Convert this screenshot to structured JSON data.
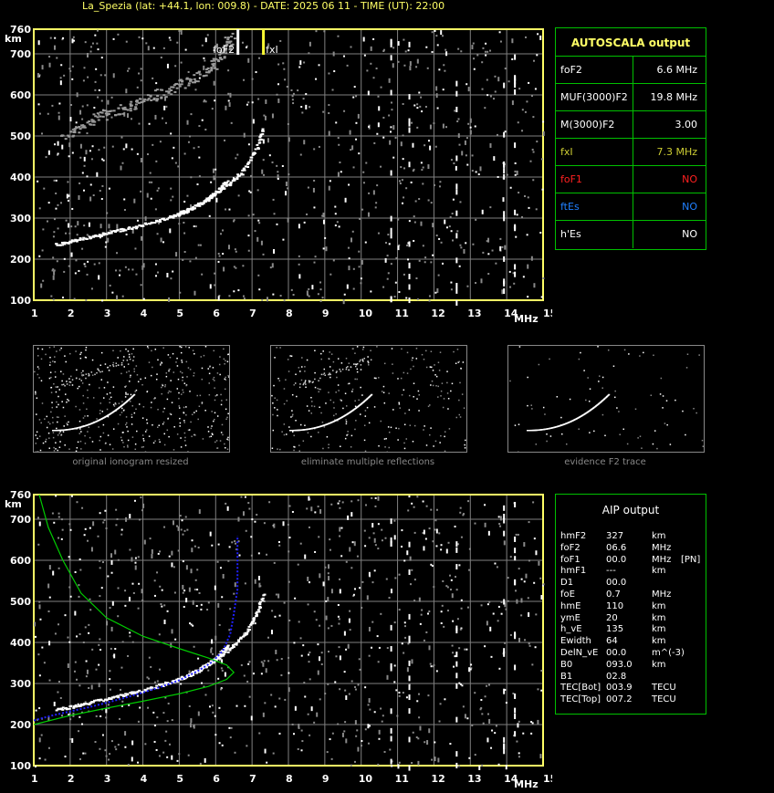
{
  "header": "La_Spezia (lat: +44.1, lon: 009.8) - DATE: 2025 06 11 - TIME (UT): 22:00",
  "colors": {
    "axis": "#ffff66",
    "grid": "#808080",
    "panel": "#00c000",
    "trace_blue": "#2020ff",
    "model_green": "#00cc00",
    "fof1": "#ff2020",
    "ftes": "#2080ff",
    "fxi": "#cccc33"
  },
  "chart_data": [
    {
      "type": "scatter",
      "name": "top-ionogram",
      "xlabel": "MHz",
      "ylabel": "km",
      "xlim": [
        1,
        15
      ],
      "ylim": [
        100,
        760
      ],
      "x_ticks": [
        1,
        2,
        3,
        4,
        5,
        6,
        7,
        8,
        9,
        10,
        11,
        12,
        13,
        14,
        15
      ],
      "y_ticks": [
        100,
        200,
        300,
        400,
        500,
        600,
        700,
        760
      ],
      "annotations": [
        {
          "text": "foF2",
          "x": 6.6
        },
        {
          "text": "fxI",
          "x": 7.3
        }
      ],
      "traces": {
        "o_trace": [
          [
            1.6,
            237
          ],
          [
            2,
            245
          ],
          [
            2.5,
            255
          ],
          [
            3,
            265
          ],
          [
            3.5,
            275
          ],
          [
            4,
            285
          ],
          [
            4.5,
            298
          ],
          [
            5,
            313
          ],
          [
            5.5,
            333
          ],
          [
            5.8,
            350
          ],
          [
            6.1,
            372
          ],
          [
            6.3,
            395
          ]
        ],
        "x_trace": [
          [
            4.8,
            305
          ],
          [
            5.2,
            320
          ],
          [
            5.6,
            340
          ],
          [
            6,
            362
          ],
          [
            6.4,
            388
          ],
          [
            6.8,
            425
          ],
          [
            7.1,
            470
          ],
          [
            7.3,
            520
          ]
        ],
        "multiple_reflections": [
          [
            1.8,
            500
          ],
          [
            2.2,
            520
          ],
          [
            2.6,
            540
          ],
          [
            3,
            555
          ],
          [
            3.4,
            565
          ],
          [
            3.8,
            580
          ],
          [
            4.2,
            595
          ],
          [
            4.6,
            610
          ],
          [
            5,
            625
          ],
          [
            5.4,
            645
          ],
          [
            5.8,
            665
          ],
          [
            6.1,
            690
          ],
          [
            6.3,
            720
          ],
          [
            6.4,
            745
          ]
        ]
      }
    },
    {
      "type": "scatter",
      "name": "bottom-ionogram",
      "xlabel": "MHz",
      "ylabel": "km",
      "xlim": [
        1,
        15
      ],
      "ylim": [
        100,
        760
      ],
      "x_ticks": [
        1,
        2,
        3,
        4,
        5,
        6,
        7,
        8,
        9,
        10,
        11,
        12,
        13,
        14,
        15
      ],
      "y_ticks": [
        100,
        200,
        300,
        400,
        500,
        600,
        700,
        760
      ],
      "traces": {
        "o_trace": [
          [
            1.6,
            237
          ],
          [
            2,
            245
          ],
          [
            2.5,
            255
          ],
          [
            3,
            265
          ],
          [
            3.5,
            275
          ],
          [
            4,
            285
          ],
          [
            4.5,
            298
          ],
          [
            5,
            313
          ],
          [
            5.5,
            333
          ],
          [
            5.8,
            350
          ],
          [
            6.1,
            372
          ],
          [
            6.3,
            395
          ]
        ],
        "x_trace": [
          [
            4.8,
            305
          ],
          [
            5.2,
            320
          ],
          [
            5.6,
            340
          ],
          [
            6,
            362
          ],
          [
            6.4,
            388
          ],
          [
            6.8,
            425
          ],
          [
            7.1,
            470
          ],
          [
            7.3,
            520
          ]
        ],
        "blue_fit": [
          [
            1,
            210
          ],
          [
            1.5,
            222
          ],
          [
            2,
            232
          ],
          [
            2.5,
            242
          ],
          [
            3,
            253
          ],
          [
            3.5,
            265
          ],
          [
            4,
            278
          ],
          [
            4.5,
            292
          ],
          [
            5,
            308
          ],
          [
            5.5,
            330
          ],
          [
            5.9,
            352
          ],
          [
            6.2,
            380
          ],
          [
            6.4,
            420
          ],
          [
            6.5,
            470
          ],
          [
            6.6,
            530
          ],
          [
            6.6,
            600
          ],
          [
            6.6,
            660
          ]
        ],
        "green_profile": [
          [
            1,
            200
          ],
          [
            2,
            222
          ],
          [
            3,
            240
          ],
          [
            4,
            257
          ],
          [
            5,
            275
          ],
          [
            5.8,
            293
          ],
          [
            6.3,
            310
          ],
          [
            6.5,
            327
          ],
          [
            6.3,
            345
          ],
          [
            5.8,
            362
          ],
          [
            5,
            385
          ],
          [
            4,
            415
          ],
          [
            3,
            460
          ],
          [
            2.3,
            520
          ],
          [
            1.8,
            600
          ],
          [
            1.4,
            680
          ],
          [
            1.15,
            760
          ]
        ]
      }
    }
  ],
  "autoscala": {
    "title": "AUTOSCALA output",
    "rows": [
      {
        "label": "foF2",
        "value": "6.6 MHz",
        "lcolor": "#ffffff",
        "vcolor": "#ffffff"
      },
      {
        "label": "MUF(3000)F2",
        "value": "19.8 MHz",
        "lcolor": "#ffffff",
        "vcolor": "#ffffff"
      },
      {
        "label": "M(3000)F2",
        "value": "3.00",
        "lcolor": "#ffffff",
        "vcolor": "#ffffff"
      },
      {
        "label": "fxI",
        "value": "7.3 MHz",
        "lcolor": "#cccc33",
        "vcolor": "#cccc33"
      },
      {
        "label": "foF1",
        "value": "NO",
        "lcolor": "#ff2020",
        "vcolor": "#ff2020"
      },
      {
        "label": "ftEs",
        "value": "NO",
        "lcolor": "#2080ff",
        "vcolor": "#2080ff"
      },
      {
        "label": "h'Es",
        "value": "NO",
        "lcolor": "#ffffff",
        "vcolor": "#ffffff"
      }
    ]
  },
  "aip": {
    "title": "AIP output",
    "rows": [
      {
        "name": "hmF2",
        "value": "327",
        "unit": "km",
        "extra": ""
      },
      {
        "name": "foF2",
        "value": "06.6",
        "unit": "MHz",
        "extra": ""
      },
      {
        "name": "foF1",
        "value": "00.0",
        "unit": "MHz",
        "extra": "[PN]"
      },
      {
        "name": "hmF1",
        "value": "---",
        "unit": "km",
        "extra": ""
      },
      {
        "name": "D1",
        "value": "00.0",
        "unit": "",
        "extra": ""
      },
      {
        "name": "foE",
        "value": "0.7",
        "unit": "MHz",
        "extra": ""
      },
      {
        "name": "hmE",
        "value": "110",
        "unit": "km",
        "extra": ""
      },
      {
        "name": "ymE",
        "value": "20",
        "unit": "km",
        "extra": ""
      },
      {
        "name": "h_vE",
        "value": "135",
        "unit": "km",
        "extra": ""
      },
      {
        "name": "Ewidth",
        "value": "64",
        "unit": "km",
        "extra": ""
      },
      {
        "name": "DelN_vE",
        "value": "00.0",
        "unit": "m^(-3)",
        "extra": ""
      },
      {
        "name": "B0",
        "value": "093.0",
        "unit": "km",
        "extra": ""
      },
      {
        "name": "B1",
        "value": "02.8",
        "unit": "",
        "extra": ""
      },
      {
        "name": "TEC[Bot]",
        "value": "003.9",
        "unit": "TECU",
        "extra": ""
      },
      {
        "name": "TEC[Top]",
        "value": "007.2",
        "unit": "TECU",
        "extra": ""
      }
    ]
  },
  "thumbnails": [
    {
      "caption": "original ionogram resized"
    },
    {
      "caption": "eliminate multiple reflections"
    },
    {
      "caption": "evidence F2 trace"
    }
  ]
}
